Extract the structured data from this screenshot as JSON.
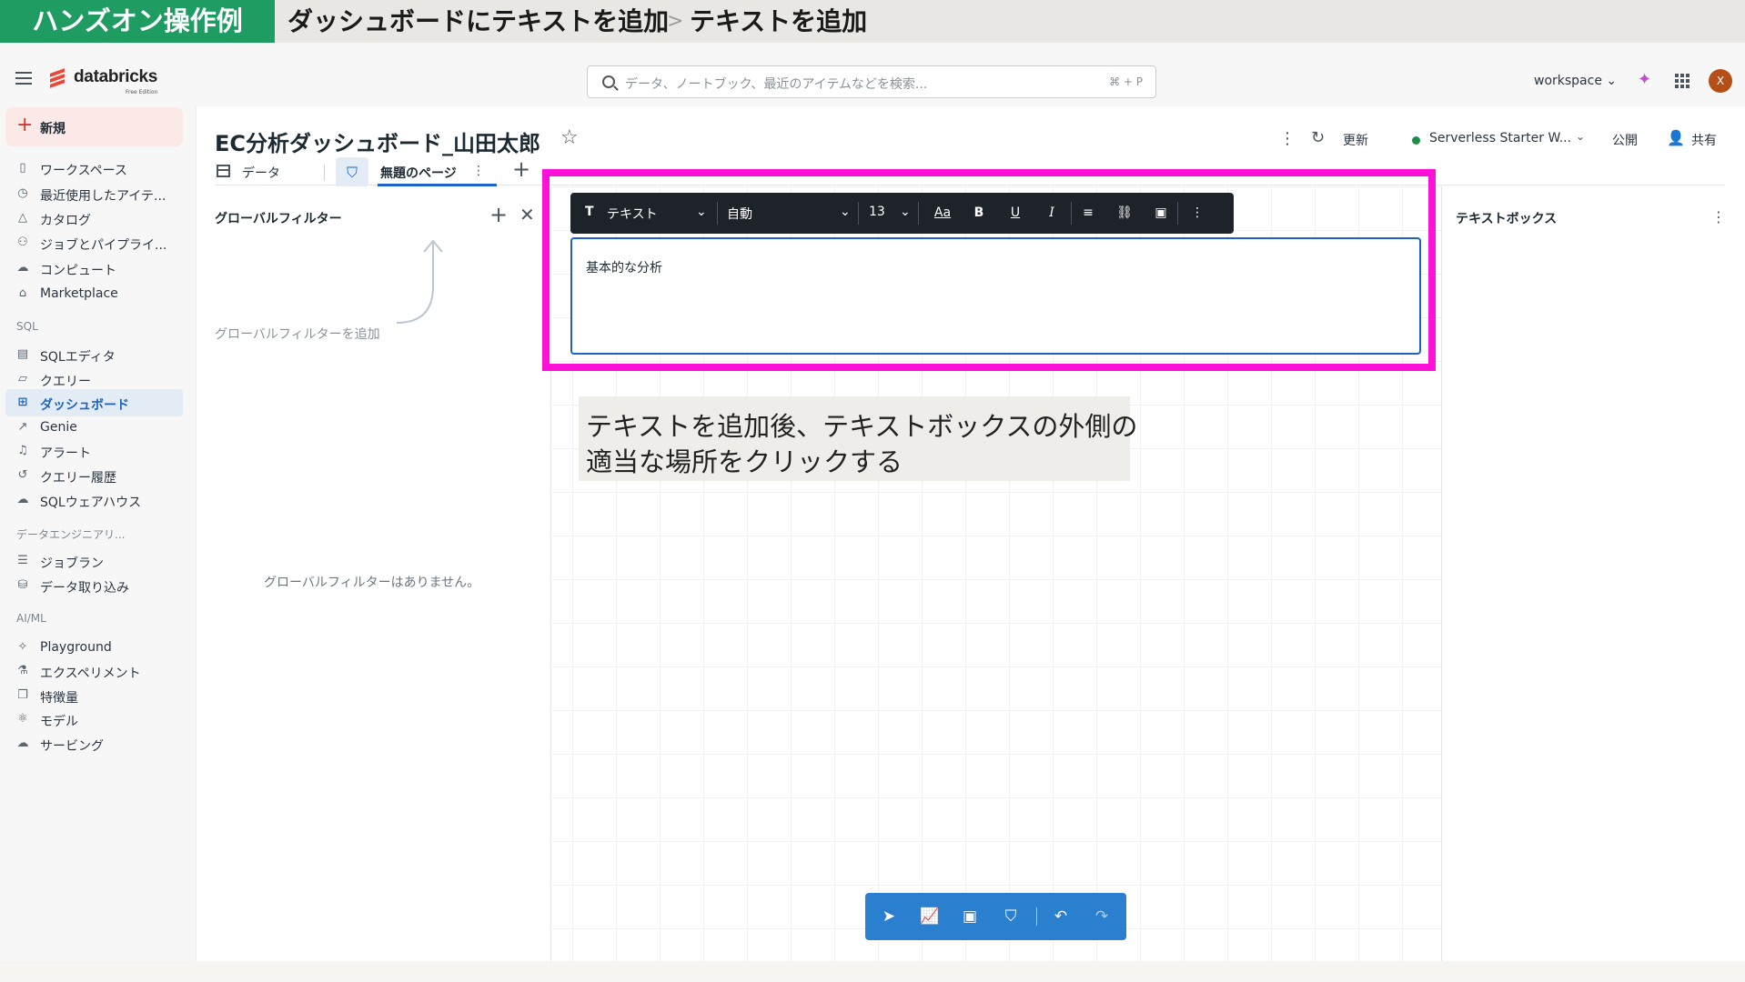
{
  "banner": {
    "tag": "ハンズオン操作例",
    "title": "ダッシュボードにテキストを追加",
    "separator": ">",
    "step": "テキストを追加"
  },
  "topbar": {
    "logo_text": "databricks",
    "logo_sub": "Free Edition",
    "search_placeholder": "データ、ノートブック、最近のアイテムなどを検索...",
    "search_shortcut": "⌘ + P",
    "workspace": "workspace",
    "avatar_initial": "X"
  },
  "sidebar": {
    "new_label": "新規",
    "items": [
      {
        "label": "ワークスペース",
        "icon": "folder-icon"
      },
      {
        "label": "最近使用したアイテ...",
        "icon": "clock-icon"
      },
      {
        "label": "カタログ",
        "icon": "catalog-icon"
      },
      {
        "label": "ジョブとパイプライ...",
        "icon": "workflow-icon"
      },
      {
        "label": "コンピュート",
        "icon": "cloud-icon"
      },
      {
        "label": "Marketplace",
        "icon": "store-icon"
      }
    ],
    "sql_section": "SQL",
    "sql_items": [
      {
        "label": "SQLエディタ",
        "icon": "editor-icon"
      },
      {
        "label": "クエリー",
        "icon": "query-icon"
      },
      {
        "label": "ダッシュボード",
        "icon": "dashboard-icon",
        "active": true
      },
      {
        "label": "Genie",
        "icon": "genie-icon"
      },
      {
        "label": "アラート",
        "icon": "bell-icon"
      },
      {
        "label": "クエリー履歴",
        "icon": "history-icon"
      },
      {
        "label": "SQLウェアハウス",
        "icon": "warehouse-icon"
      }
    ],
    "de_section": "データエンジニアリ...",
    "de_items": [
      {
        "label": "ジョブラン",
        "icon": "list-icon"
      },
      {
        "label": "データ取り込み",
        "icon": "ingest-icon"
      }
    ],
    "ml_section": "AI/ML",
    "ml_items": [
      {
        "label": "Playground",
        "icon": "playground-icon"
      },
      {
        "label": "エクスペリメント",
        "icon": "flask-icon"
      },
      {
        "label": "特徴量",
        "icon": "feature-icon"
      },
      {
        "label": "モデル",
        "icon": "model-icon"
      },
      {
        "label": "サービング",
        "icon": "serving-icon"
      }
    ]
  },
  "header": {
    "title": "EC分析ダッシュボード_山田太郎",
    "refresh": "更新",
    "warehouse": "Serverless Starter W...",
    "publish": "公開",
    "share": "共有"
  },
  "tabs": {
    "data": "データ",
    "page": "無題のページ"
  },
  "filters": {
    "title": "グローバルフィルター",
    "hint": "グローバルフィルターを追加",
    "empty": "グローバルフィルターはありません。"
  },
  "text_toolbar": {
    "type": "テキスト",
    "font": "自動",
    "size": "13",
    "aa": "Aa",
    "bold": "B",
    "underline": "U",
    "italic": "I"
  },
  "editor": {
    "text": "基本的な分析"
  },
  "props": {
    "title": "テキストボックス"
  },
  "callout": {
    "line1": "テキストを追加後、テキストボックスの外側の",
    "line2": "適当な場所をクリックする"
  },
  "colors": {
    "brand_green": "#1f9c62",
    "highlight": "#ff10d8",
    "accent_blue": "#1d63c6",
    "toolbar_dark": "#1e2329",
    "bottom_toolbar": "#2a7fcf"
  }
}
